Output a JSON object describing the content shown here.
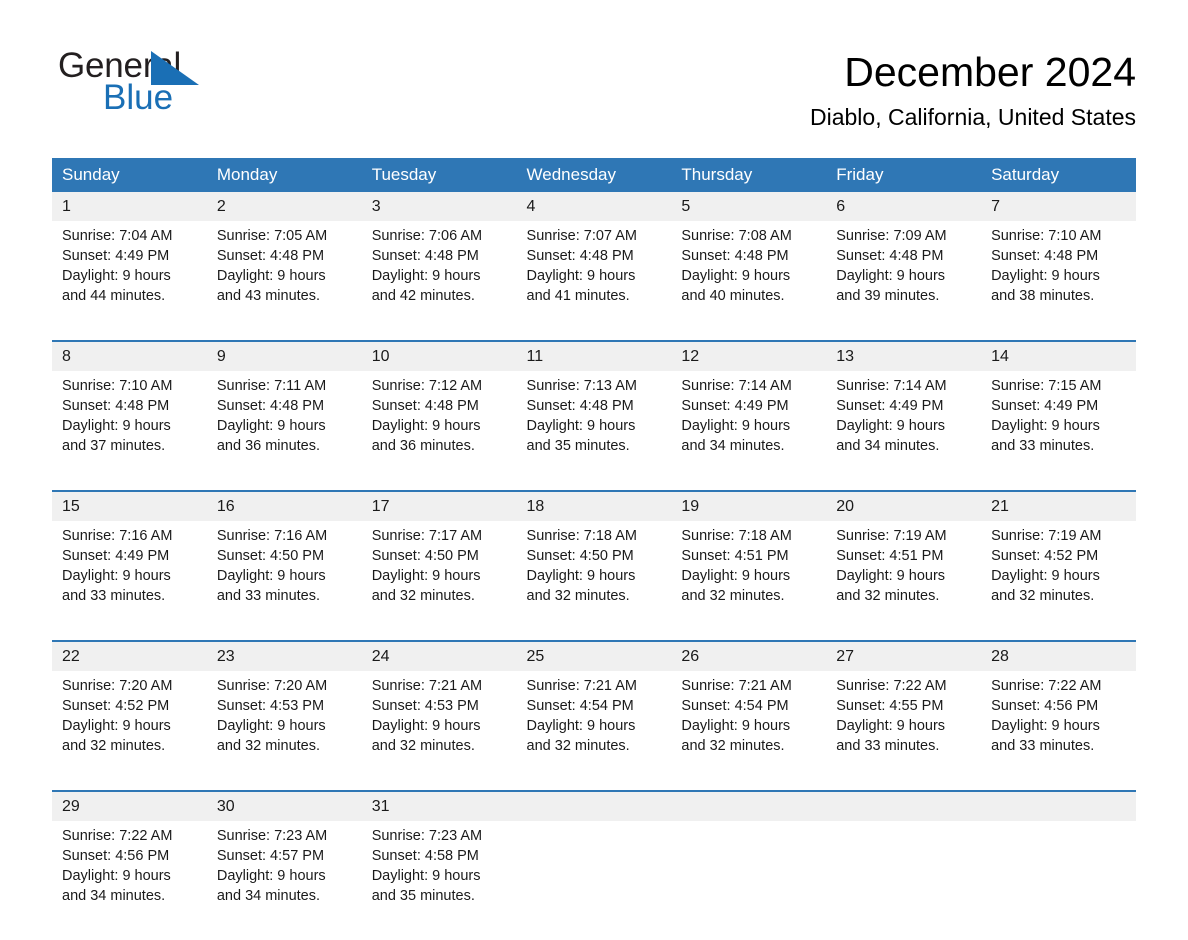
{
  "brand": {
    "name_part1": "General",
    "name_part2": "Blue",
    "triangle_icon": "triangle-icon",
    "accent_color": "#1a6fb5"
  },
  "header": {
    "title": "December 2024",
    "subtitle": "Diablo, California, United States"
  },
  "calendar": {
    "header_bg": "#2f77b5",
    "daynum_bg": "#f0f0f0",
    "weekday_headers": [
      "Sunday",
      "Monday",
      "Tuesday",
      "Wednesday",
      "Thursday",
      "Friday",
      "Saturday"
    ],
    "weeks": [
      [
        {
          "day": "1",
          "sunrise": "Sunrise: 7:04 AM",
          "sunset": "Sunset: 4:49 PM",
          "daylight_line1": "Daylight: 9 hours",
          "daylight_line2": "and 44 minutes."
        },
        {
          "day": "2",
          "sunrise": "Sunrise: 7:05 AM",
          "sunset": "Sunset: 4:48 PM",
          "daylight_line1": "Daylight: 9 hours",
          "daylight_line2": "and 43 minutes."
        },
        {
          "day": "3",
          "sunrise": "Sunrise: 7:06 AM",
          "sunset": "Sunset: 4:48 PM",
          "daylight_line1": "Daylight: 9 hours",
          "daylight_line2": "and 42 minutes."
        },
        {
          "day": "4",
          "sunrise": "Sunrise: 7:07 AM",
          "sunset": "Sunset: 4:48 PM",
          "daylight_line1": "Daylight: 9 hours",
          "daylight_line2": "and 41 minutes."
        },
        {
          "day": "5",
          "sunrise": "Sunrise: 7:08 AM",
          "sunset": "Sunset: 4:48 PM",
          "daylight_line1": "Daylight: 9 hours",
          "daylight_line2": "and 40 minutes."
        },
        {
          "day": "6",
          "sunrise": "Sunrise: 7:09 AM",
          "sunset": "Sunset: 4:48 PM",
          "daylight_line1": "Daylight: 9 hours",
          "daylight_line2": "and 39 minutes."
        },
        {
          "day": "7",
          "sunrise": "Sunrise: 7:10 AM",
          "sunset": "Sunset: 4:48 PM",
          "daylight_line1": "Daylight: 9 hours",
          "daylight_line2": "and 38 minutes."
        }
      ],
      [
        {
          "day": "8",
          "sunrise": "Sunrise: 7:10 AM",
          "sunset": "Sunset: 4:48 PM",
          "daylight_line1": "Daylight: 9 hours",
          "daylight_line2": "and 37 minutes."
        },
        {
          "day": "9",
          "sunrise": "Sunrise: 7:11 AM",
          "sunset": "Sunset: 4:48 PM",
          "daylight_line1": "Daylight: 9 hours",
          "daylight_line2": "and 36 minutes."
        },
        {
          "day": "10",
          "sunrise": "Sunrise: 7:12 AM",
          "sunset": "Sunset: 4:48 PM",
          "daylight_line1": "Daylight: 9 hours",
          "daylight_line2": "and 36 minutes."
        },
        {
          "day": "11",
          "sunrise": "Sunrise: 7:13 AM",
          "sunset": "Sunset: 4:48 PM",
          "daylight_line1": "Daylight: 9 hours",
          "daylight_line2": "and 35 minutes."
        },
        {
          "day": "12",
          "sunrise": "Sunrise: 7:14 AM",
          "sunset": "Sunset: 4:49 PM",
          "daylight_line1": "Daylight: 9 hours",
          "daylight_line2": "and 34 minutes."
        },
        {
          "day": "13",
          "sunrise": "Sunrise: 7:14 AM",
          "sunset": "Sunset: 4:49 PM",
          "daylight_line1": "Daylight: 9 hours",
          "daylight_line2": "and 34 minutes."
        },
        {
          "day": "14",
          "sunrise": "Sunrise: 7:15 AM",
          "sunset": "Sunset: 4:49 PM",
          "daylight_line1": "Daylight: 9 hours",
          "daylight_line2": "and 33 minutes."
        }
      ],
      [
        {
          "day": "15",
          "sunrise": "Sunrise: 7:16 AM",
          "sunset": "Sunset: 4:49 PM",
          "daylight_line1": "Daylight: 9 hours",
          "daylight_line2": "and 33 minutes."
        },
        {
          "day": "16",
          "sunrise": "Sunrise: 7:16 AM",
          "sunset": "Sunset: 4:50 PM",
          "daylight_line1": "Daylight: 9 hours",
          "daylight_line2": "and 33 minutes."
        },
        {
          "day": "17",
          "sunrise": "Sunrise: 7:17 AM",
          "sunset": "Sunset: 4:50 PM",
          "daylight_line1": "Daylight: 9 hours",
          "daylight_line2": "and 32 minutes."
        },
        {
          "day": "18",
          "sunrise": "Sunrise: 7:18 AM",
          "sunset": "Sunset: 4:50 PM",
          "daylight_line1": "Daylight: 9 hours",
          "daylight_line2": "and 32 minutes."
        },
        {
          "day": "19",
          "sunrise": "Sunrise: 7:18 AM",
          "sunset": "Sunset: 4:51 PM",
          "daylight_line1": "Daylight: 9 hours",
          "daylight_line2": "and 32 minutes."
        },
        {
          "day": "20",
          "sunrise": "Sunrise: 7:19 AM",
          "sunset": "Sunset: 4:51 PM",
          "daylight_line1": "Daylight: 9 hours",
          "daylight_line2": "and 32 minutes."
        },
        {
          "day": "21",
          "sunrise": "Sunrise: 7:19 AM",
          "sunset": "Sunset: 4:52 PM",
          "daylight_line1": "Daylight: 9 hours",
          "daylight_line2": "and 32 minutes."
        }
      ],
      [
        {
          "day": "22",
          "sunrise": "Sunrise: 7:20 AM",
          "sunset": "Sunset: 4:52 PM",
          "daylight_line1": "Daylight: 9 hours",
          "daylight_line2": "and 32 minutes."
        },
        {
          "day": "23",
          "sunrise": "Sunrise: 7:20 AM",
          "sunset": "Sunset: 4:53 PM",
          "daylight_line1": "Daylight: 9 hours",
          "daylight_line2": "and 32 minutes."
        },
        {
          "day": "24",
          "sunrise": "Sunrise: 7:21 AM",
          "sunset": "Sunset: 4:53 PM",
          "daylight_line1": "Daylight: 9 hours",
          "daylight_line2": "and 32 minutes."
        },
        {
          "day": "25",
          "sunrise": "Sunrise: 7:21 AM",
          "sunset": "Sunset: 4:54 PM",
          "daylight_line1": "Daylight: 9 hours",
          "daylight_line2": "and 32 minutes."
        },
        {
          "day": "26",
          "sunrise": "Sunrise: 7:21 AM",
          "sunset": "Sunset: 4:54 PM",
          "daylight_line1": "Daylight: 9 hours",
          "daylight_line2": "and 32 minutes."
        },
        {
          "day": "27",
          "sunrise": "Sunrise: 7:22 AM",
          "sunset": "Sunset: 4:55 PM",
          "daylight_line1": "Daylight: 9 hours",
          "daylight_line2": "and 33 minutes."
        },
        {
          "day": "28",
          "sunrise": "Sunrise: 7:22 AM",
          "sunset": "Sunset: 4:56 PM",
          "daylight_line1": "Daylight: 9 hours",
          "daylight_line2": "and 33 minutes."
        }
      ],
      [
        {
          "day": "29",
          "sunrise": "Sunrise: 7:22 AM",
          "sunset": "Sunset: 4:56 PM",
          "daylight_line1": "Daylight: 9 hours",
          "daylight_line2": "and 34 minutes."
        },
        {
          "day": "30",
          "sunrise": "Sunrise: 7:23 AM",
          "sunset": "Sunset: 4:57 PM",
          "daylight_line1": "Daylight: 9 hours",
          "daylight_line2": "and 34 minutes."
        },
        {
          "day": "31",
          "sunrise": "Sunrise: 7:23 AM",
          "sunset": "Sunset: 4:58 PM",
          "daylight_line1": "Daylight: 9 hours",
          "daylight_line2": "and 35 minutes."
        },
        {
          "day": "",
          "sunrise": "",
          "sunset": "",
          "daylight_line1": "",
          "daylight_line2": ""
        },
        {
          "day": "",
          "sunrise": "",
          "sunset": "",
          "daylight_line1": "",
          "daylight_line2": ""
        },
        {
          "day": "",
          "sunrise": "",
          "sunset": "",
          "daylight_line1": "",
          "daylight_line2": ""
        },
        {
          "day": "",
          "sunrise": "",
          "sunset": "",
          "daylight_line1": "",
          "daylight_line2": ""
        }
      ]
    ]
  }
}
